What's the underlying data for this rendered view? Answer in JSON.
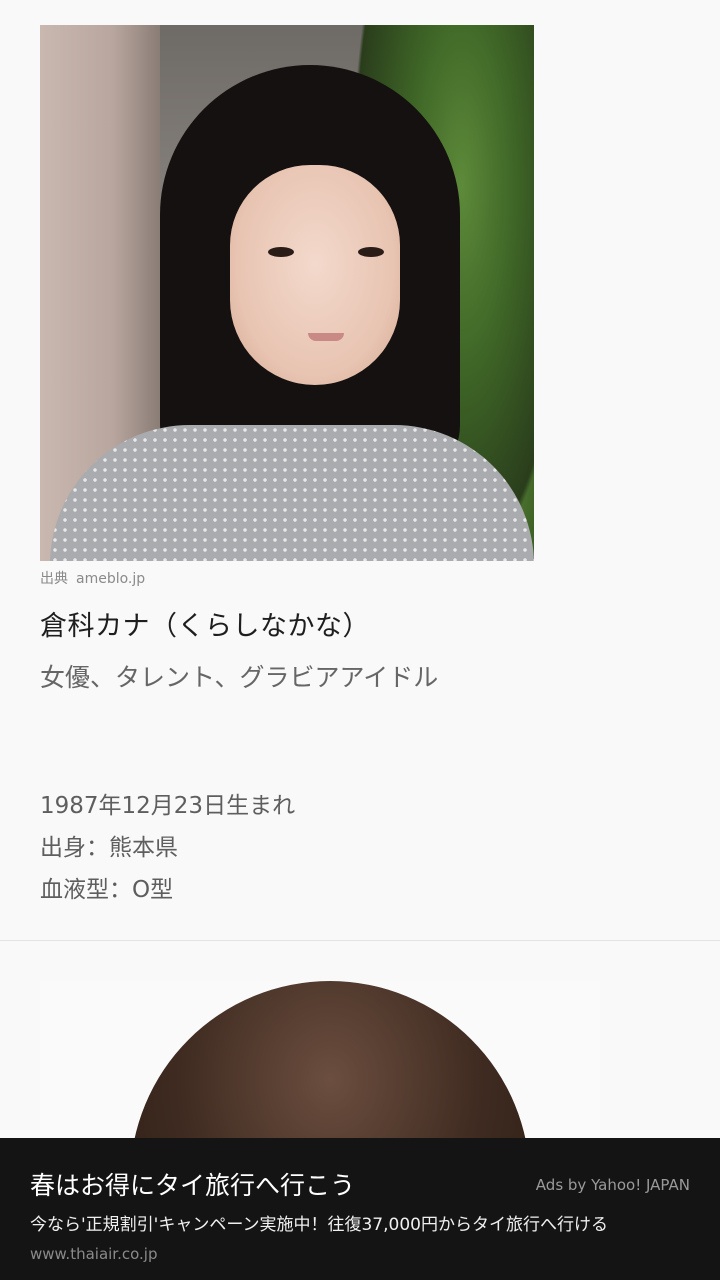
{
  "profile": {
    "caption_label": "出典",
    "caption_source": "ameblo.jp",
    "name": "倉科カナ（くらしなかな）",
    "role": "女優、タレント、グラビアアイドル",
    "details": [
      "1987年12月23日生まれ",
      "出身：熊本県",
      "血液型：O型"
    ]
  },
  "ad": {
    "title": "春はお得にタイ旅行へ行こう",
    "badge": "Ads by Yahoo! JAPAN",
    "description": "今なら'正規割引'キャンペーン実施中！往復37,000円からタイ旅行へ行ける",
    "url": "www.thaiair.co.jp"
  }
}
